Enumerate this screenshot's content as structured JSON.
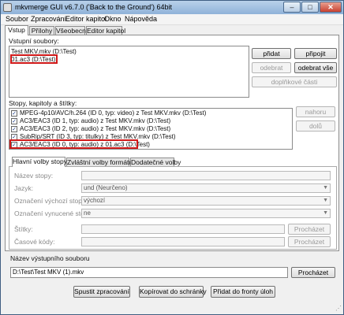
{
  "window": {
    "title": "mkvmerge GUI v6.7.0 ('Back to the Ground') 64bit",
    "minimize": "–",
    "maximize": "□",
    "close": "✕"
  },
  "menu": [
    "Soubor",
    "Zpracování",
    "Editor kapitol",
    "Okno",
    "Nápověda"
  ],
  "tabs": [
    "Vstup",
    "Přílohy",
    "Všeobecné",
    "Editor kapitol"
  ],
  "input_files": {
    "label": "Vstupní soubory:",
    "items": [
      "Test MKV.mkv (D:\\Test)",
      "01.ac3 (D:\\Test)"
    ]
  },
  "file_buttons": {
    "add": "přidat",
    "append": "připojit",
    "remove": "odebrat",
    "remove_all": "odebrat vše",
    "additional_parts": "doplňkové části"
  },
  "tracks": {
    "label": "Stopy, kapitoly a štítky:",
    "items": [
      "MPEG-4p10/AVC/h.264 (ID 0, typ: video) z Test MKV.mkv (D:\\Test)",
      "AC3/EAC3 (ID 1, typ: audio) z Test MKV.mkv (D:\\Test)",
      "AC3/EAC3 (ID 2, typ: audio) z Test MKV.mkv (D:\\Test)",
      "SubRip/SRT (ID 3, typ: titulky) z Test MKV.mkv (D:\\Test)",
      "AC3/EAC3 (ID 0, typ: audio) z 01.ac3 (D:\\Test)"
    ],
    "check_mark": "✓"
  },
  "track_buttons": {
    "up": "nahoru",
    "down": "dolů"
  },
  "options_tabs": [
    "Hlavní volby stopy",
    "Zvláštní volby formátu",
    "Dodatečné volby"
  ],
  "options": {
    "track_name": {
      "label": "Název stopy:",
      "value": ""
    },
    "language": {
      "label": "Jazyk:",
      "value": "und (Neurčeno)"
    },
    "default_track": {
      "label": "Označení výchozí stopy:",
      "value": "výchozí"
    },
    "forced_track": {
      "label": "Označení vynucené stopy:",
      "value": "ne"
    },
    "tags": {
      "label": "Štítky:",
      "value": "",
      "browse": "Procházet"
    },
    "timecodes": {
      "label": "Časové kódy:",
      "value": "",
      "browse": "Procházet"
    }
  },
  "output": {
    "label": "Název výstupního souboru",
    "value": "D:\\Test\\Test MKV (1).mkv",
    "browse": "Procházet"
  },
  "actions": {
    "start": "Spustit zpracování",
    "copy": "Kopírovat do schránky",
    "queue": "Přidat do fronty úloh"
  }
}
